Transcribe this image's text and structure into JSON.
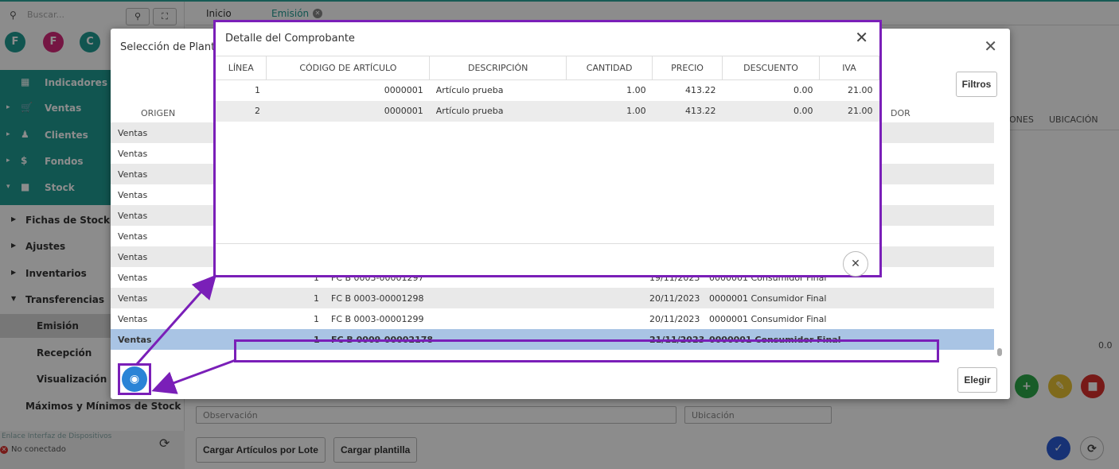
{
  "app": {
    "search_placeholder": "Buscar...",
    "avatars": [
      {
        "letter": "F",
        "color": "#1f9b93"
      },
      {
        "letter": "F",
        "color": "#d6287a"
      },
      {
        "letter": "C",
        "color": "#1f9b93"
      }
    ],
    "tabs": [
      {
        "label": "Inicio"
      },
      {
        "label": "Emisión"
      }
    ],
    "menu_teal": [
      {
        "label": "Indicadores"
      },
      {
        "label": "Ventas"
      },
      {
        "label": "Clientes"
      },
      {
        "label": "Fondos"
      },
      {
        "label": "Stock"
      }
    ],
    "menu": [
      {
        "label": "Fichas de Stock"
      },
      {
        "label": "Ajustes"
      },
      {
        "label": "Inventarios"
      },
      {
        "label": "Transferencias"
      },
      {
        "label": "Emisión"
      },
      {
        "label": "Recepción"
      },
      {
        "label": "Visualización"
      },
      {
        "label": "Máximos y Mínimos de Stock"
      }
    ],
    "device_link": "Enlace Interfaz de Dispositivos",
    "status": "No conectado",
    "observacion_placeholder": "Observación",
    "ubicacion_placeholder": "Ubicación",
    "btn_lote": "Cargar Artículos por Lote",
    "btn_plantilla": "Cargar plantilla",
    "right_cols": [
      "ONES",
      "UBICACIÓN"
    ],
    "right_value": "0.0",
    "colors": {
      "accent_teal": "#1f9b93",
      "highlight": "#7a1fb8",
      "selected_row": "#a9c4e4"
    }
  },
  "template_modal": {
    "title": "Selección de Plant",
    "filtros": "Filtros",
    "col_origen": "ORIGEN",
    "col_dor": "DOR",
    "elegir": "Elegir",
    "rows": [
      {
        "origen": "Ventas",
        "num": "",
        "comp": "",
        "fecha": "",
        "cliente": ""
      },
      {
        "origen": "Ventas",
        "num": "",
        "comp": "",
        "fecha": "",
        "cliente": ""
      },
      {
        "origen": "Ventas",
        "num": "",
        "comp": "",
        "fecha": "",
        "cliente": ""
      },
      {
        "origen": "Ventas",
        "num": "",
        "comp": "",
        "fecha": "",
        "cliente": ""
      },
      {
        "origen": "Ventas",
        "num": "",
        "comp": "",
        "fecha": "",
        "cliente": ""
      },
      {
        "origen": "Ventas",
        "num": "",
        "comp": "",
        "fecha": "",
        "cliente": ""
      },
      {
        "origen": "Ventas",
        "num": "",
        "comp": "",
        "fecha": "",
        "cliente": ""
      },
      {
        "origen": "Ventas",
        "num": "1",
        "comp": "FC B 0003-00001297",
        "fecha": "19/11/2023",
        "cliente": "0000001 Consumidor Final"
      },
      {
        "origen": "Ventas",
        "num": "1",
        "comp": "FC B 0003-00001298",
        "fecha": "20/11/2023",
        "cliente": "0000001 Consumidor Final"
      },
      {
        "origen": "Ventas",
        "num": "1",
        "comp": "FC B 0003-00001299",
        "fecha": "20/11/2023",
        "cliente": "0000001 Consumidor Final"
      },
      {
        "origen": "Ventas",
        "num": "1",
        "comp": "FC B 0009-00002178",
        "fecha": "21/11/2023",
        "cliente": "0000001 Consumidor Final"
      }
    ]
  },
  "detail_modal": {
    "title": "Detalle del Comprobante",
    "columns": [
      "LÍNEA",
      "CÓDIGO DE ARTÍCULO",
      "DESCRIPCIÓN",
      "CANTIDAD",
      "PRECIO",
      "DESCUENTO",
      "IVA"
    ],
    "rows": [
      [
        "1",
        "0000001",
        "Artículo prueba",
        "1.00",
        "413.22",
        "0.00",
        "21.00"
      ],
      [
        "2",
        "0000001",
        "Artículo prueba",
        "1.00",
        "413.22",
        "0.00",
        "21.00"
      ]
    ]
  }
}
